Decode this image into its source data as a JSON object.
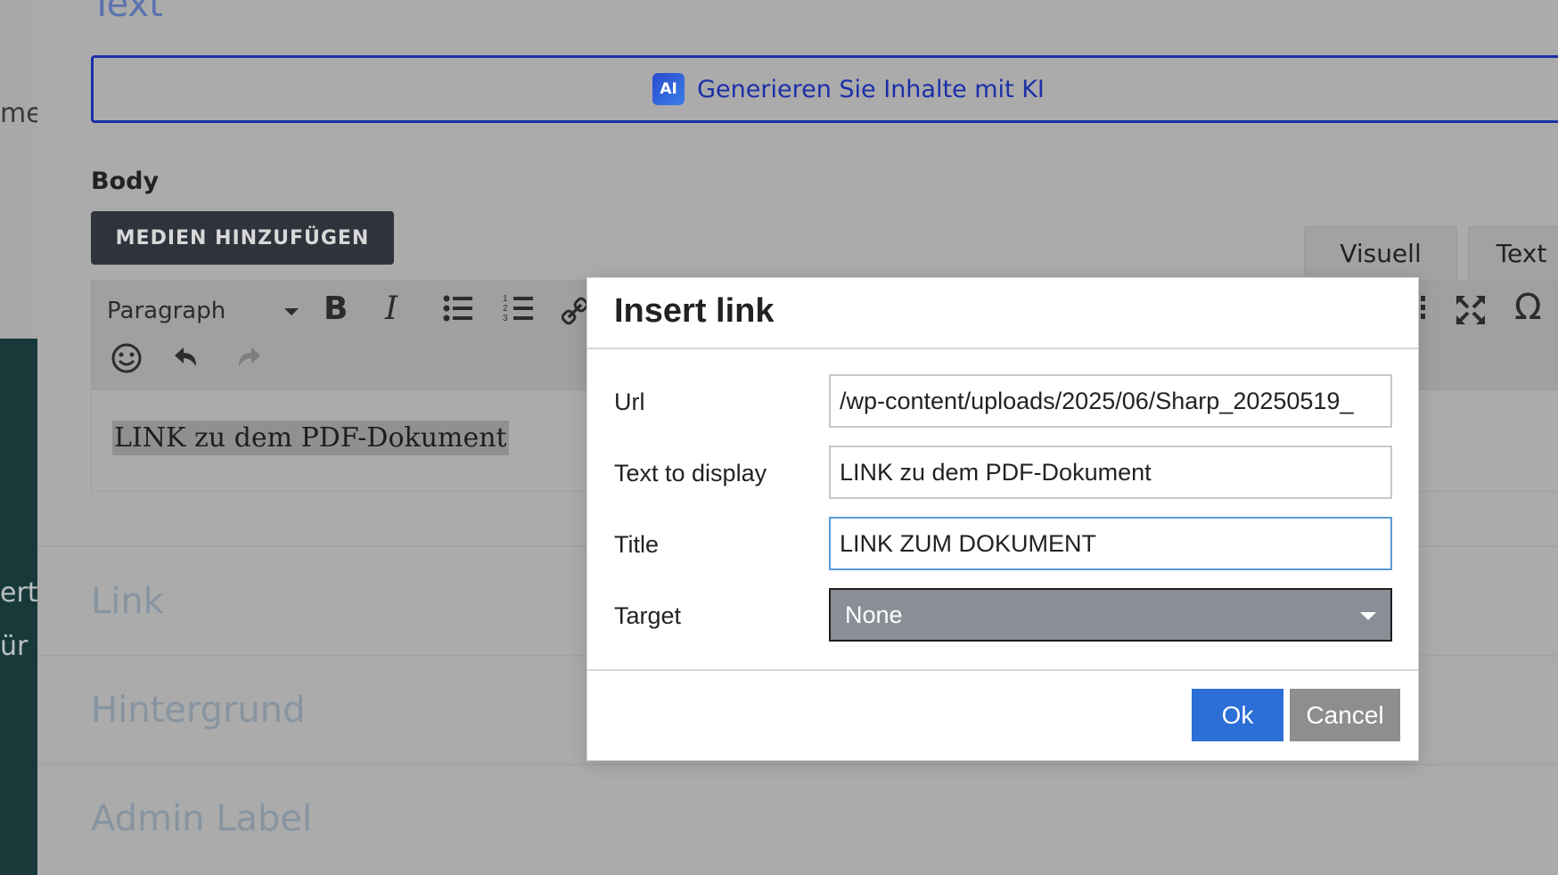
{
  "left": {
    "snippet_1": "me",
    "snippet_2": "ert",
    "snippet_3": "ür u"
  },
  "sections": {
    "text_partial": "Text",
    "link": "Link",
    "background": "Hintergrund",
    "admin_label": "Admin Label"
  },
  "ai_bar": {
    "badge": "AI",
    "label": "Generieren Sie Inhalte mit KI"
  },
  "body_label": "Body",
  "media_button": "MEDIEN HINZUFÜGEN",
  "editor_tabs": {
    "visual": "Visuell",
    "text": "Text"
  },
  "toolbar": {
    "format_select": "Paragraph",
    "bold": "B",
    "italic": "I",
    "omega": "Ω"
  },
  "editor_content": "LINK zu dem PDF-Dokument",
  "dialog": {
    "title": "Insert link",
    "url_label": "Url",
    "url_value": "/wp-content/uploads/2025/06/Sharp_20250519_",
    "text_label": "Text to display",
    "text_value": "LINK zu dem PDF-Dokument",
    "title_label": "Title",
    "title_value": "LINK ZUM DOKUMENT",
    "target_label": "Target",
    "target_value": "None",
    "ok_label": "Ok",
    "cancel_label": "Cancel"
  },
  "colors": {
    "overlay_bg": "#b0b0b0",
    "ai_accent": "#1b2fa8",
    "ok_button": "#2c6fd6",
    "cancel_button": "#8e8e8e",
    "dark_strip": "#18393a"
  }
}
